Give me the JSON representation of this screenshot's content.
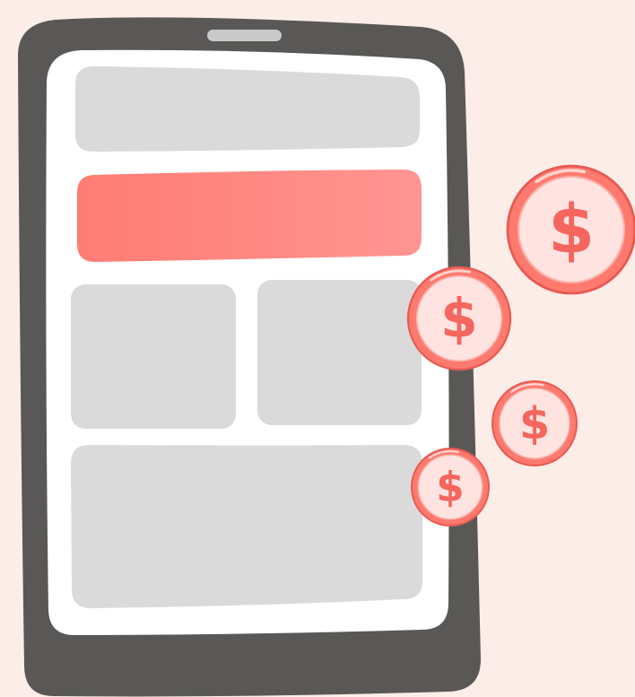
{
  "colors": {
    "background": "#FDEDE8",
    "device_body": "#595856",
    "device_screen": "#FFFFFF",
    "speaker_slot": "#C9C9C9",
    "placeholder_block": "#DADADA",
    "highlight_bar_start": "#FF7C73",
    "highlight_bar_end": "#FF9592",
    "coin_outer": "#FF7A6E",
    "coin_outer_stroke": "#E85A52",
    "coin_inner": "#FFE3E0",
    "coin_symbol": "#F4665E"
  },
  "device": {
    "icon": "smartphone-icon",
    "screen_blocks": [
      {
        "name": "top-banner-placeholder",
        "kind": "placeholder"
      },
      {
        "name": "highlight-bar",
        "kind": "accent"
      },
      {
        "name": "left-card-placeholder",
        "kind": "placeholder"
      },
      {
        "name": "right-card-placeholder",
        "kind": "placeholder"
      },
      {
        "name": "bottom-panel-placeholder",
        "kind": "placeholder"
      }
    ]
  },
  "coins": {
    "icon": "dollar-coin-icon",
    "count": 4,
    "symbol": "$"
  }
}
